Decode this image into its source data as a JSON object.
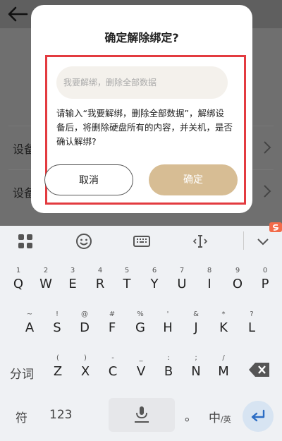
{
  "background": {
    "rows": [
      {
        "label": "设备"
      },
      {
        "label": "设备"
      }
    ]
  },
  "dialog": {
    "title": "确定解除绑定?",
    "input_placeholder": "我要解绑，删除全部数据",
    "message": "请输入“我要解绑，删除全部数据”，解绑设备后，将删除硬盘所有的内容，并关机，是否确认解绑?",
    "cancel_label": "取消",
    "confirm_label": "确定"
  },
  "keyboard": {
    "toolbar": [
      "apps-icon",
      "emoji-icon",
      "keyboard-icon",
      "cursor-icon",
      "chevron-down-icon"
    ],
    "row1": [
      {
        "sub": "1",
        "main": "Q"
      },
      {
        "sub": "2",
        "main": "W"
      },
      {
        "sub": "3",
        "main": "E"
      },
      {
        "sub": "4",
        "main": "R"
      },
      {
        "sub": "5",
        "main": "T"
      },
      {
        "sub": "6",
        "main": "Y"
      },
      {
        "sub": "7",
        "main": "U"
      },
      {
        "sub": "8",
        "main": "I"
      },
      {
        "sub": "9",
        "main": "O"
      },
      {
        "sub": "0",
        "main": "P"
      }
    ],
    "row2": [
      {
        "sub": "~",
        "main": "A"
      },
      {
        "sub": "!",
        "main": "S"
      },
      {
        "sub": "@",
        "main": "D"
      },
      {
        "sub": "#",
        "main": "F"
      },
      {
        "sub": "%",
        "main": "G"
      },
      {
        "sub": "'",
        "main": "H"
      },
      {
        "sub": "&",
        "main": "J"
      },
      {
        "sub": "*",
        "main": "K"
      },
      {
        "sub": "?",
        "main": "L"
      }
    ],
    "row3": [
      {
        "sub": "(",
        "main": "Z"
      },
      {
        "sub": ")",
        "main": "X"
      },
      {
        "sub": "-",
        "main": "C"
      },
      {
        "sub": "_",
        "main": "V"
      },
      {
        "sub": ":",
        "main": "B"
      },
      {
        "sub": ";",
        "main": "N"
      },
      {
        "sub": "/",
        "main": "M"
      }
    ],
    "fenci_label": "分词",
    "symbol_label": "符",
    "num_label": "123",
    "period_label": "。",
    "lang_label_main": "中",
    "lang_label_sub": "/英"
  }
}
